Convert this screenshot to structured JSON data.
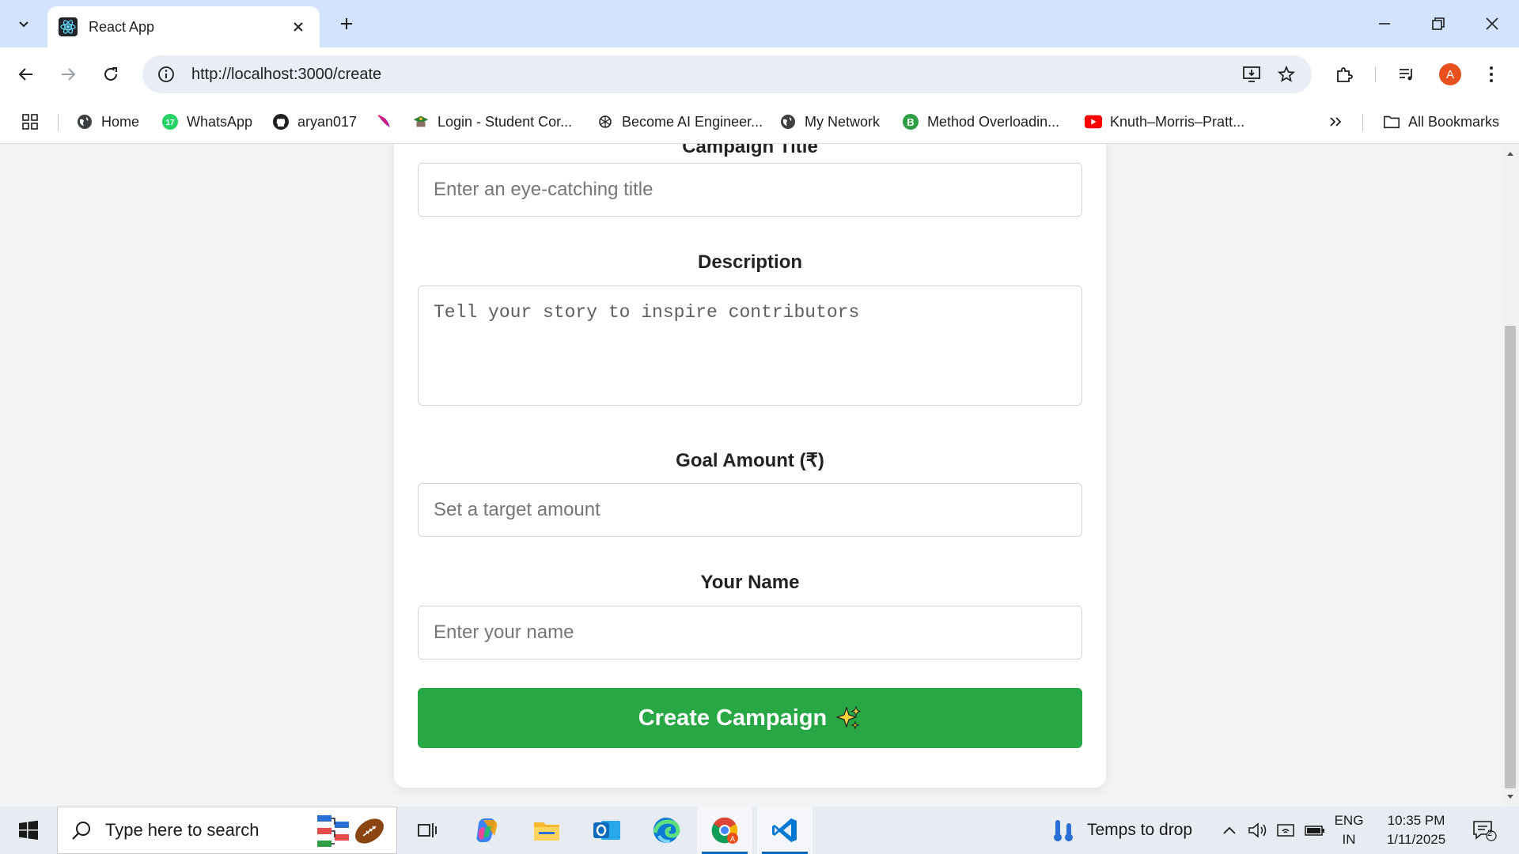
{
  "browser": {
    "tab_title": "React App",
    "url": "http://localhost:3000/create",
    "profile_initial": "A"
  },
  "bookmarks": [
    {
      "label": "Home",
      "icon": "globe-icon"
    },
    {
      "label": "WhatsApp",
      "icon": "whatsapp-icon"
    },
    {
      "label": "aryan017",
      "icon": "github-icon"
    },
    {
      "label": "",
      "icon": "leaf-icon"
    },
    {
      "label": "Login - Student Cor...",
      "icon": "student-portal-icon"
    },
    {
      "label": "Become AI Engineer...",
      "icon": "openai-icon"
    },
    {
      "label": "My Network",
      "icon": "globe-icon"
    },
    {
      "label": "Method Overloadin...",
      "icon": "b-icon"
    },
    {
      "label": "Knuth–Morris–Pratt...",
      "icon": "youtube-icon"
    }
  ],
  "all_bookmarks_label": "All Bookmarks",
  "form": {
    "title_label": "Campaign Title",
    "title_placeholder": "Enter an eye-catching title",
    "description_label": "Description",
    "description_placeholder": "Tell your story to inspire contributors",
    "goal_label": "Goal Amount (₹)",
    "goal_placeholder": "Set a target amount",
    "name_label": "Your Name",
    "name_placeholder": "Enter your name",
    "submit_label": "Create Campaign"
  },
  "taskbar": {
    "search_placeholder": "Type here to search",
    "weather_text": "Temps to drop",
    "lang_line1": "ENG",
    "lang_line2": "IN",
    "time": "10:35 PM",
    "date": "1/11/2025",
    "notification_count": "2"
  },
  "colors": {
    "submit_button": "#28a745",
    "tab_strip": "#d3e3fd",
    "avatar": "#e8501d"
  }
}
